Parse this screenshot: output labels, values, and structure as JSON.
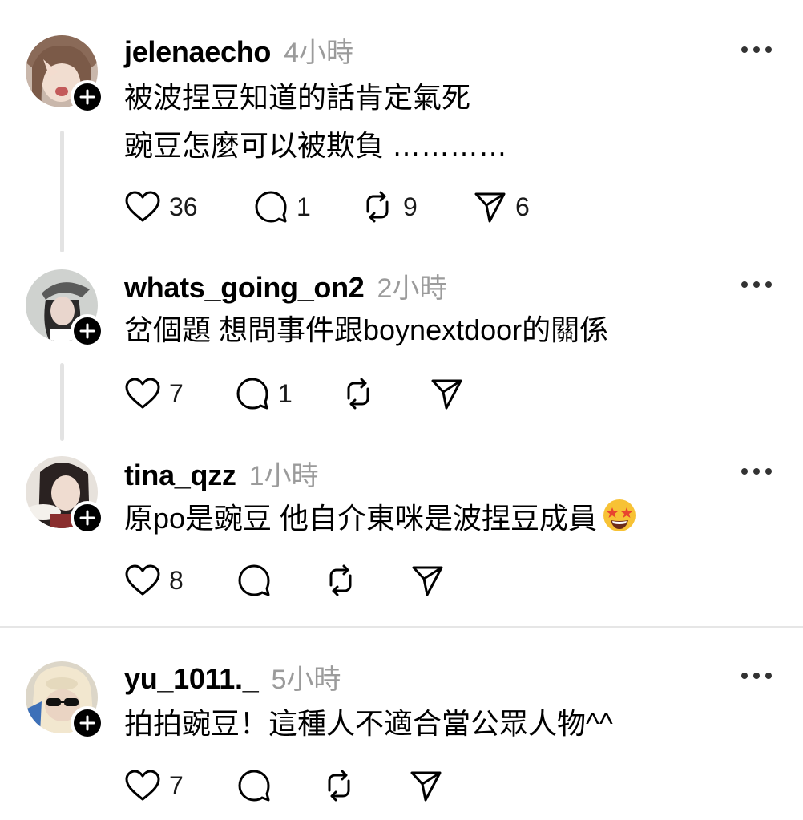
{
  "comments": [
    {
      "username": "jelenaecho",
      "time": "4小時",
      "lines": [
        "被波捏豆知道的話肯定氣死",
        "豌豆怎麼可以被欺負 …………"
      ],
      "likes": "36",
      "replies": "1",
      "reposts": "9",
      "shares": "6"
    },
    {
      "username": "whats_going_on2",
      "time": "2小時",
      "lines": [
        "岔個題 想問事件跟boynextdoor的關係"
      ],
      "likes": "7",
      "replies": "1",
      "reposts": "",
      "shares": ""
    },
    {
      "username": "tina_qzz",
      "time": "1小時",
      "lines": [
        "原po是豌豆 他自介東咪是波捏豆成員"
      ],
      "likes": "8",
      "replies": "",
      "reposts": "",
      "shares": ""
    },
    {
      "username": "yu_1011._",
      "time": "5小時",
      "lines": [
        "拍拍豌豆！這種人不適合當公眾人物^^"
      ],
      "likes": "7",
      "replies": "",
      "reposts": "",
      "shares": ""
    }
  ],
  "icons": {
    "like": "heart-icon",
    "reply": "comment-bubble-icon",
    "repost": "repost-icon",
    "share": "send-icon",
    "more": "more-dots-icon",
    "follow": "plus-icon",
    "emoji": "star-struck-emoji"
  },
  "colors": {
    "text": "#000000",
    "muted": "#9b9b9b",
    "thread_line": "#e3e3e3",
    "divider": "#e6e6e6"
  }
}
